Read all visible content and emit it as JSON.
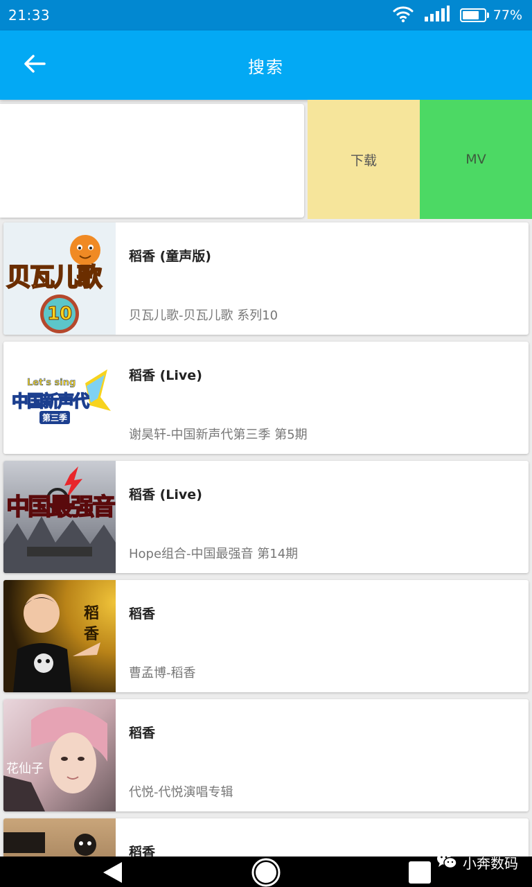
{
  "status_bar": {
    "time": "21:33",
    "battery_percent": "77%",
    "battery_level": 0.77,
    "wifi_icon": "wifi-icon",
    "signal_icon": "signal-icon"
  },
  "app_bar": {
    "title": "搜索",
    "back_icon": "arrow-left-icon",
    "color": "#03a9f4"
  },
  "swipe_actions": {
    "download_label": "下载",
    "mv_label": "MV",
    "download_color": "#f6e59b",
    "mv_color": "#4cd964"
  },
  "results": [
    {
      "title": "稻香 (童声版)",
      "subtitle": "贝瓦儿歌-贝瓦儿歌 系列10",
      "cover_text": "贝瓦儿歌",
      "cover_badge": "10"
    },
    {
      "title": "稻香 (Live)",
      "subtitle": "谢昊轩-中国新声代第三季 第5期",
      "cover_text": "中国新声代",
      "cover_small": "Let's sing",
      "cover_badge": "第三季"
    },
    {
      "title": "稻香 (Live)",
      "subtitle": "Hope组合-中国最强音 第14期",
      "cover_text": "中国最强音"
    },
    {
      "title": "稻香",
      "subtitle": "曹孟博-稻香",
      "cover_text": "稻香"
    },
    {
      "title": "稻香",
      "subtitle": "代悦-代悦演唱专辑",
      "cover_text": "花仙子"
    },
    {
      "title": "稻香",
      "subtitle": ""
    }
  ],
  "watermark": {
    "text": "小奔数码",
    "icon": "wechat-icon"
  },
  "nav_bar": {
    "back_icon": "nav-back-icon",
    "home_icon": "nav-home-icon",
    "recent_icon": "nav-recent-icon"
  }
}
